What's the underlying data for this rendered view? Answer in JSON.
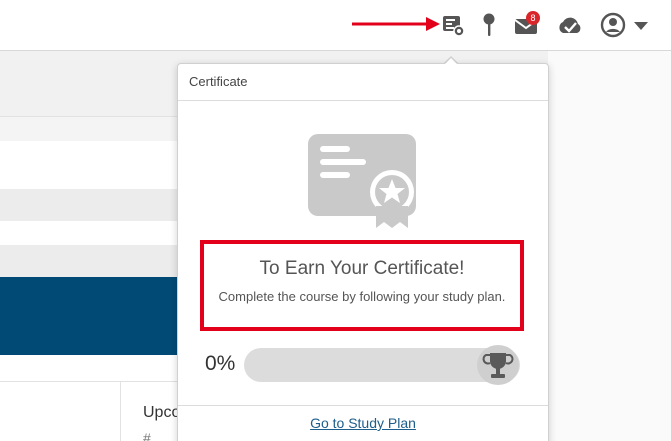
{
  "header": {
    "icons": [
      {
        "icon": "certificate-icon"
      },
      {
        "icon": "pin-icon"
      },
      {
        "icon": "mail-icon",
        "badge": "8"
      },
      {
        "icon": "cloud-check-icon"
      },
      {
        "icon": "user-account-icon"
      },
      {
        "icon": "caret-down-icon"
      }
    ]
  },
  "background": {
    "partial_heading": "Upco",
    "partial_symbol": "#"
  },
  "popover": {
    "title": "Certificate",
    "earn_title": "To Earn Your Certificate!",
    "earn_text": "Complete the course by following your study plan.",
    "progress_label": "0%",
    "progress_fraction": 0,
    "link_label": "Go to Study Plan"
  },
  "colors": {
    "annotation_red": "#e2001a",
    "badge_red": "#d9262b",
    "brand_blue": "#004a75",
    "icon_gray": "#555555",
    "graphic_gray": "#c9c9c9"
  }
}
